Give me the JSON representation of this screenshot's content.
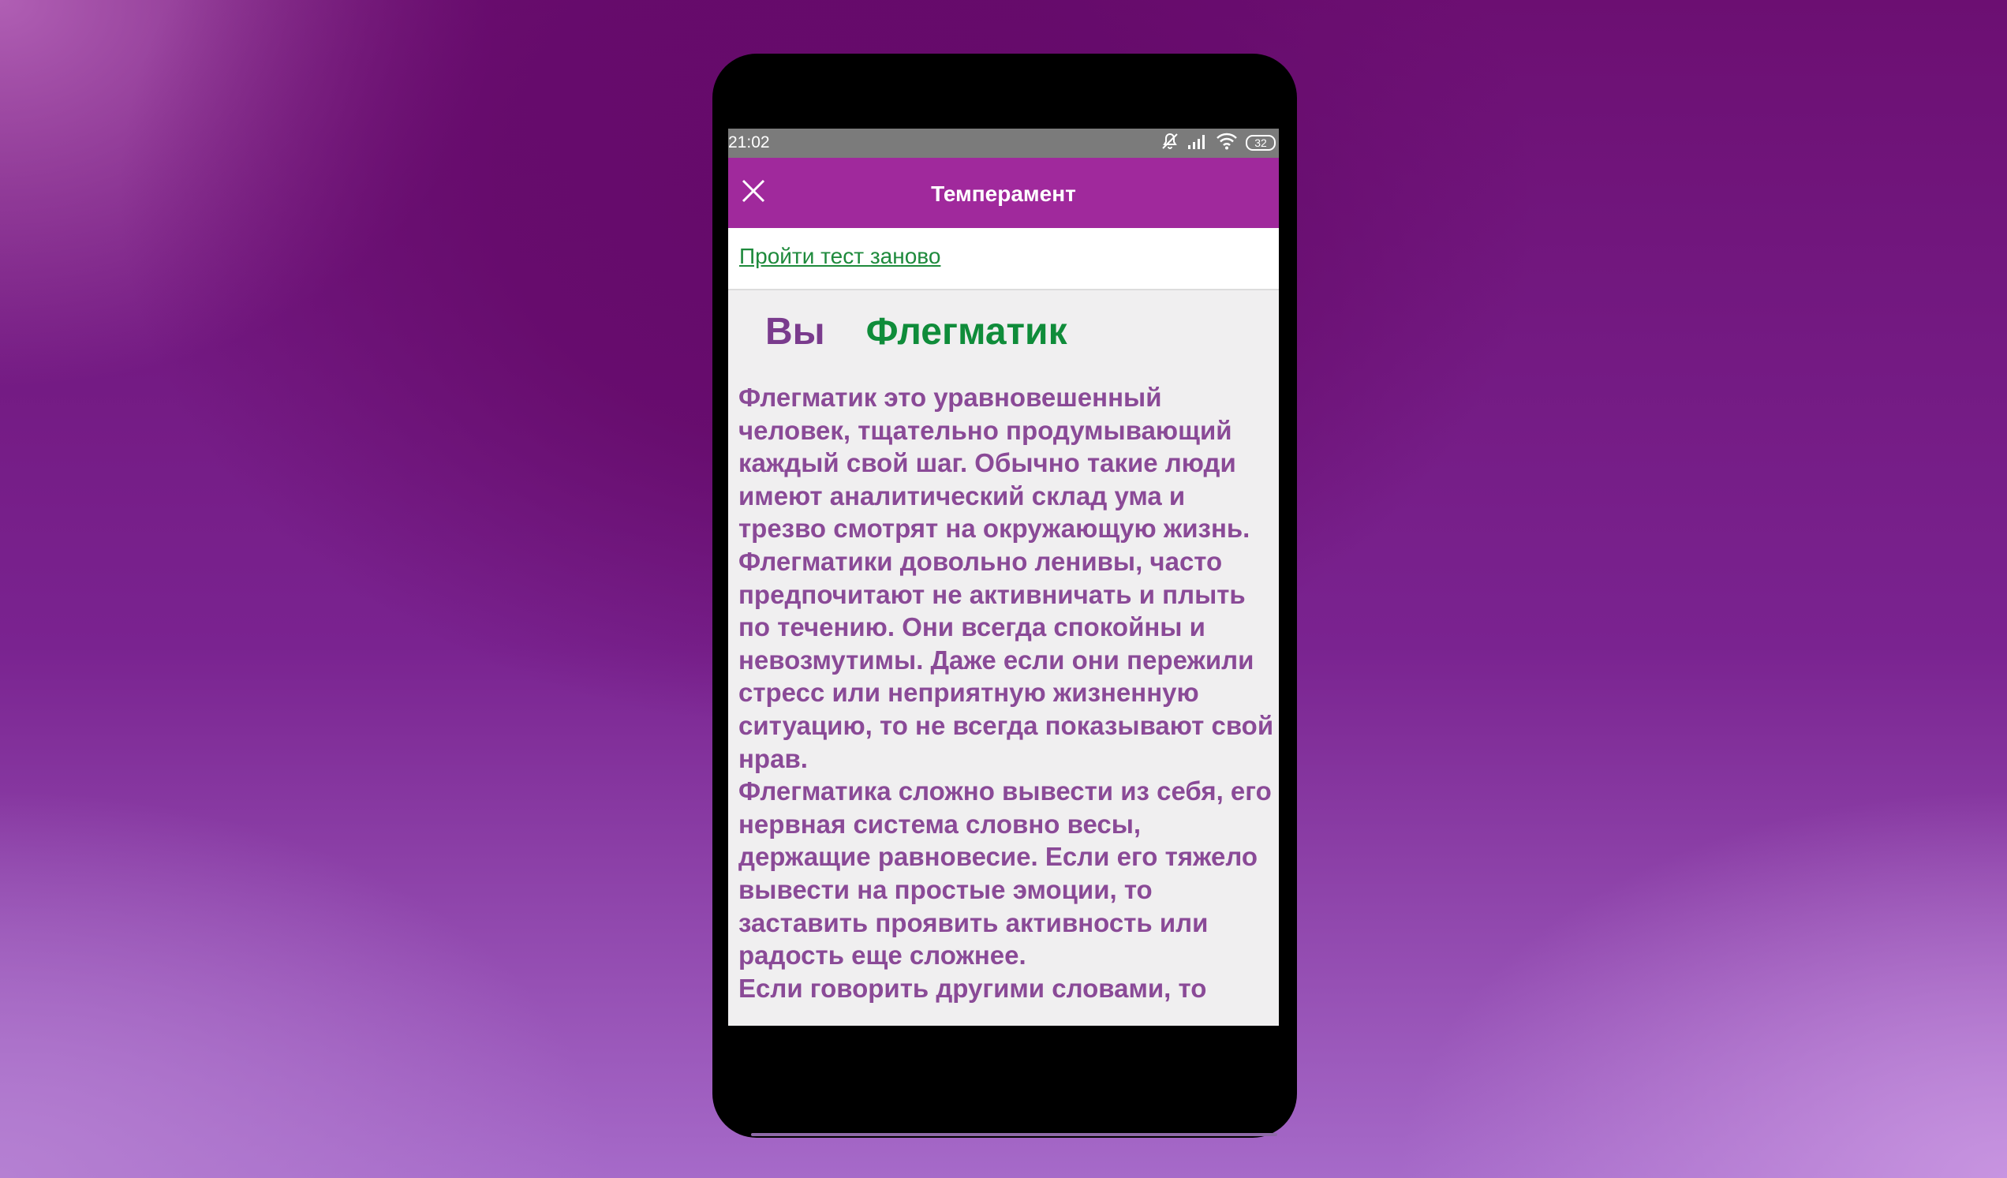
{
  "statusbar": {
    "time": "21:02",
    "battery": "32",
    "icons": [
      "mute-bell-icon",
      "signal-icon",
      "wifi-icon",
      "battery-icon"
    ]
  },
  "appbar": {
    "title": "Темперамент",
    "close_icon": "close-icon",
    "color": "#a0299c"
  },
  "retake_link": "Пройти тест заново",
  "result": {
    "prefix": "Вы",
    "type": "Флегматик"
  },
  "description": {
    "paragraphs": [
      "Флегматик это уравновешенный человек, тщательно продумывающий каждый свой шаг. Обычно такие люди имеют аналитический склад ума и трезво смотрят на окружающую жизнь.",
      "Флегматики довольно ленивы, часто предпочитают не активничать и плыть по течению. Они всегда спокойны и невозмутимы. Даже если они пережили стресс или неприятную жизненную ситуацию, то не всегда показывают свой нрав.",
      "Флегматика сложно вывести из себя, его нервная система словно весы, держащие равновесие. Если его тяжело вывести на простые эмоции, то заставить проявить активность или радость еще сложнее.",
      "Если говорить другими словами, то"
    ]
  },
  "colors": {
    "link": "#1e8a3c",
    "result_you": "#7a3b8d",
    "result_type": "#0f8c3a",
    "text": "#8a4a97"
  }
}
